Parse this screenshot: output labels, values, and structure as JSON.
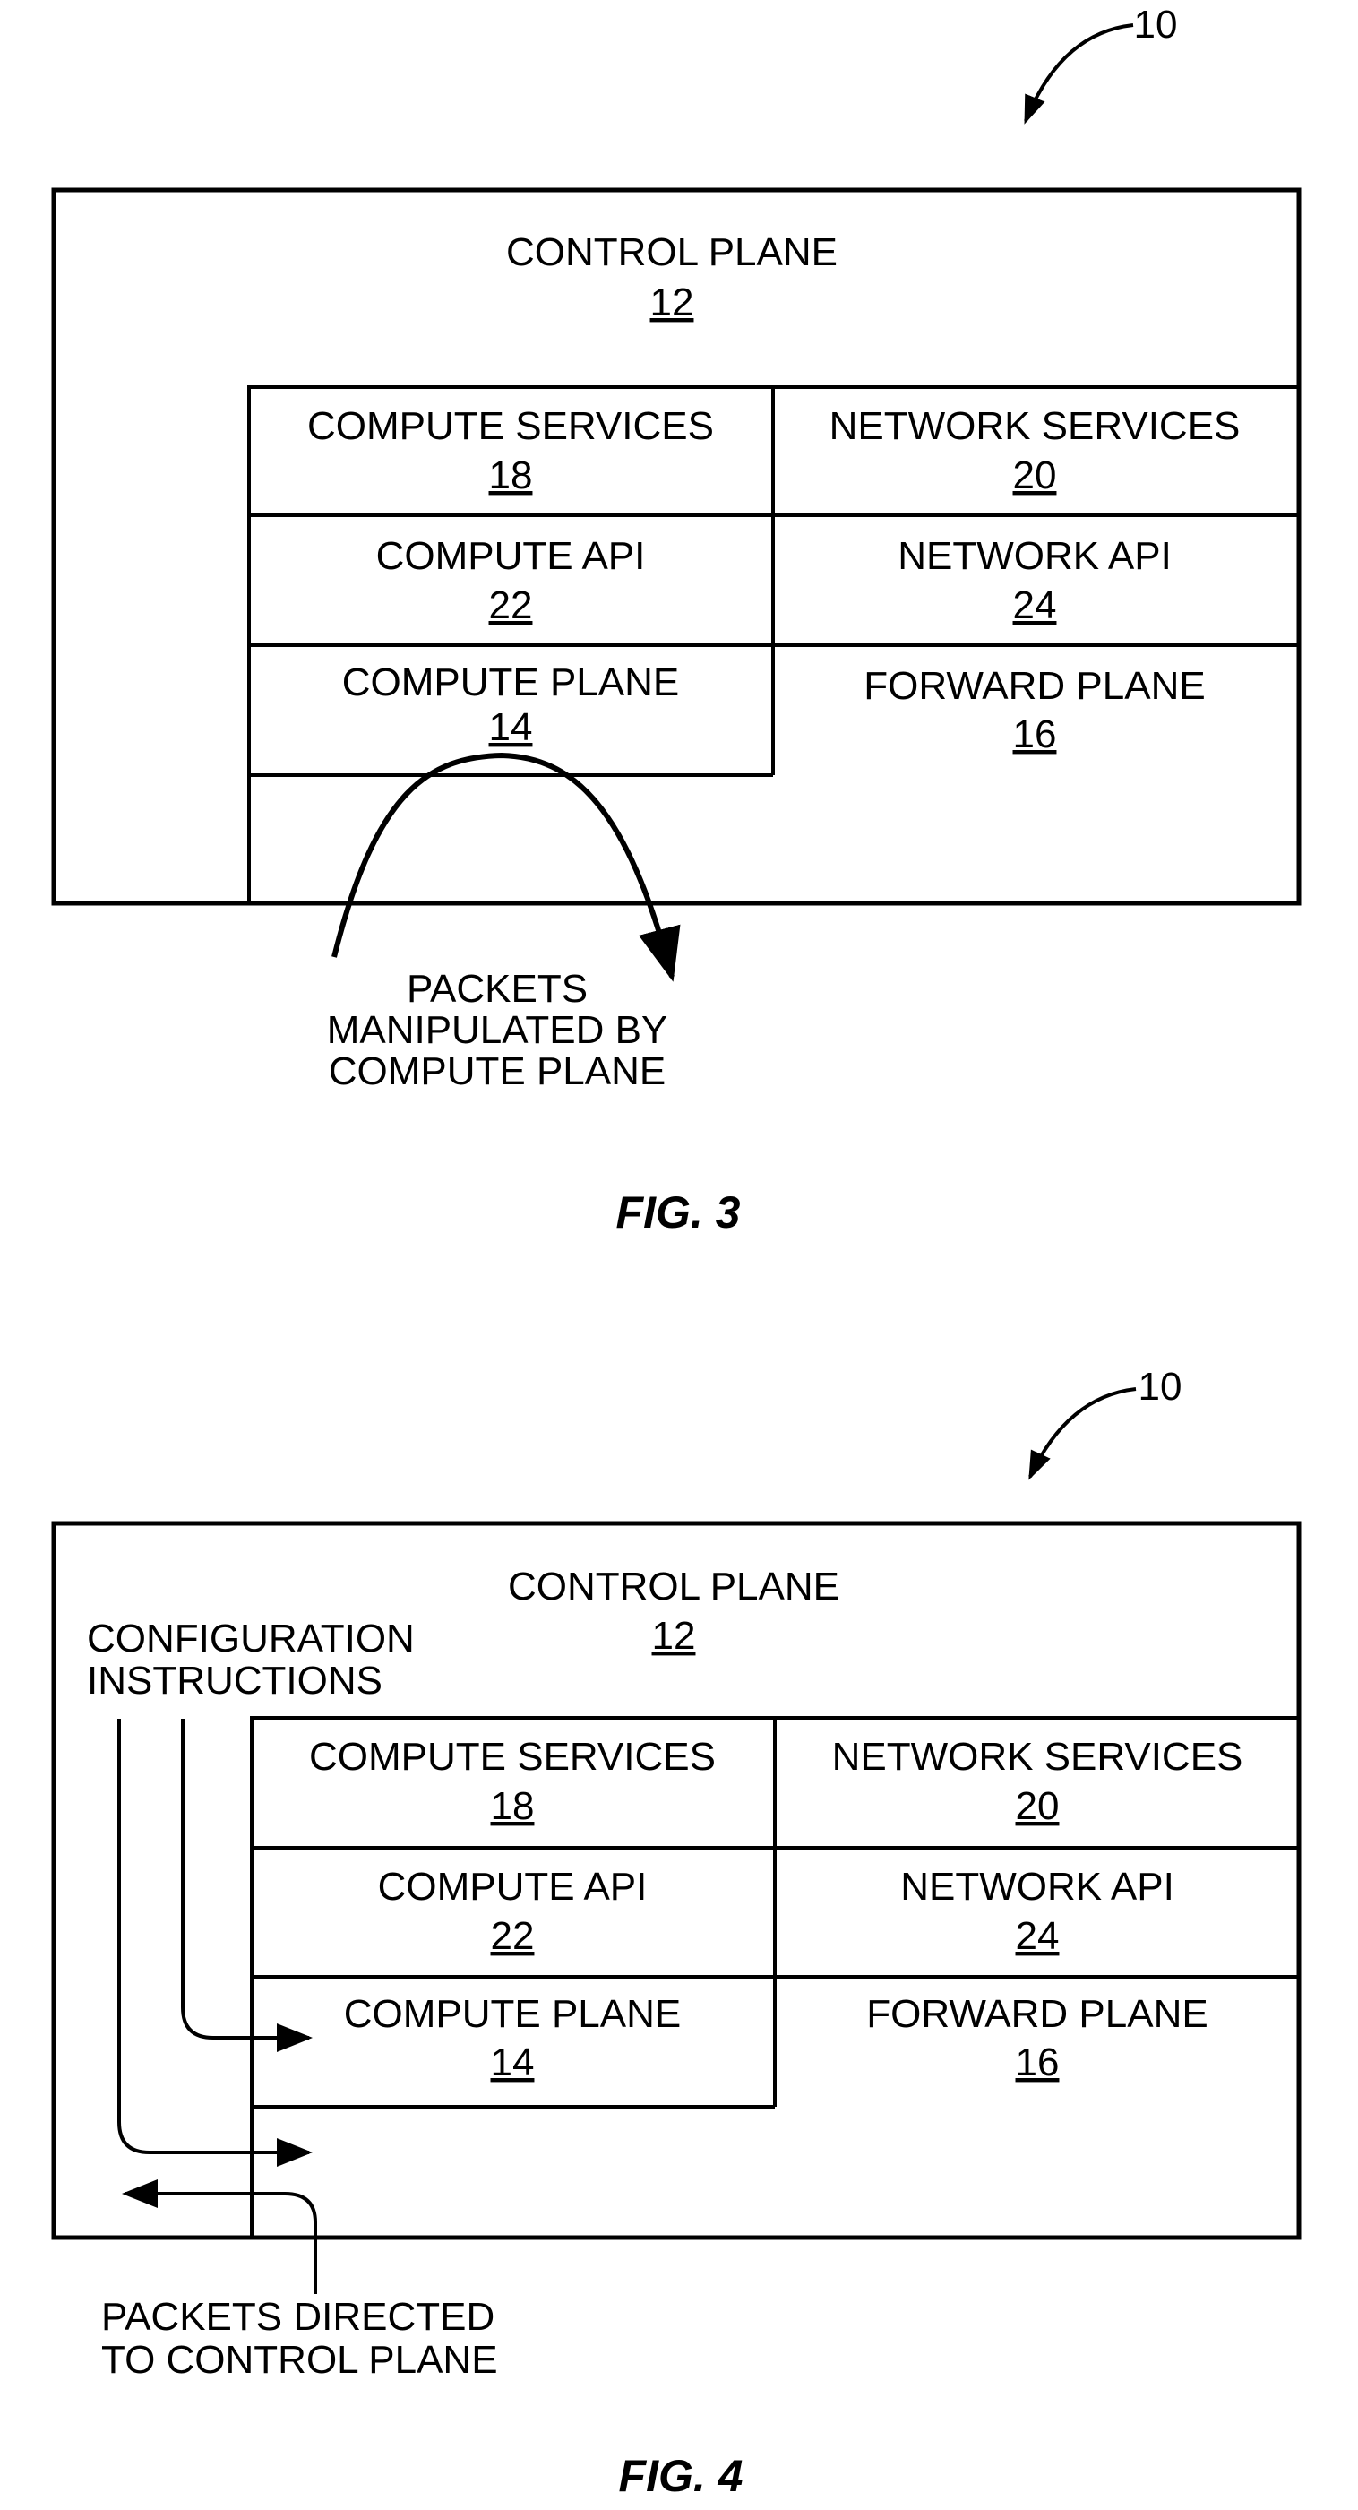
{
  "figures": [
    {
      "caption": "FIG. 3",
      "reference": "10",
      "control_plane": {
        "label": "CONTROL PLANE",
        "ref": "12"
      },
      "cells": [
        {
          "label": "COMPUTE SERVICES",
          "ref": "18"
        },
        {
          "label": "NETWORK SERVICES",
          "ref": "20"
        },
        {
          "label": "COMPUTE API",
          "ref": "22"
        },
        {
          "label": "NETWORK API",
          "ref": "24"
        },
        {
          "label": "COMPUTE PLANE",
          "ref": "14"
        },
        {
          "label": "FORWARD PLANE",
          "ref": "16"
        }
      ],
      "annotation": [
        "PACKETS",
        "MANIPULATED BY",
        "COMPUTE PLANE"
      ]
    },
    {
      "caption": "FIG. 4",
      "reference": "10",
      "control_plane": {
        "label": "CONTROL PLANE",
        "ref": "12"
      },
      "config_label": [
        "CONFIGURATION",
        "INSTRUCTIONS"
      ],
      "cells": [
        {
          "label": "COMPUTE SERVICES",
          "ref": "18"
        },
        {
          "label": "NETWORK SERVICES",
          "ref": "20"
        },
        {
          "label": "COMPUTE API",
          "ref": "22"
        },
        {
          "label": "NETWORK API",
          "ref": "24"
        },
        {
          "label": "COMPUTE PLANE",
          "ref": "14"
        },
        {
          "label": "FORWARD PLANE",
          "ref": "16"
        }
      ],
      "annotation": [
        "PACKETS DIRECTED",
        "TO CONTROL PLANE"
      ]
    }
  ]
}
